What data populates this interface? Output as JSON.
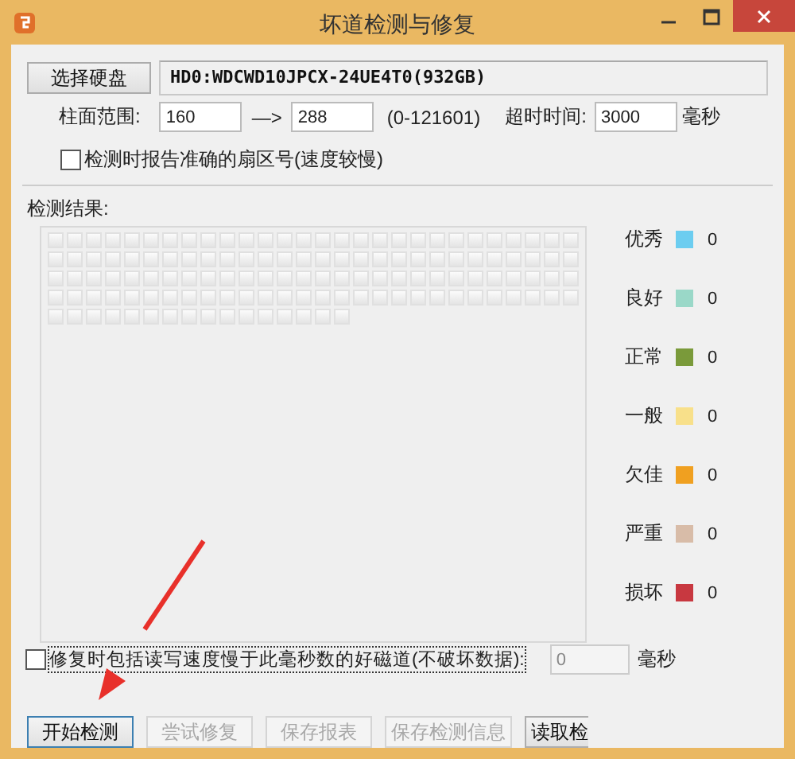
{
  "window": {
    "title": "坏道检测与修复"
  },
  "disk": {
    "button": "选择硬盘",
    "value": "HD0:WDCWD10JPCX-24UE4T0(932GB)"
  },
  "cylinder_range": {
    "label": "柱面范围:",
    "from": "160",
    "arrow": "—>",
    "to": "288",
    "limits": "(0-121601)"
  },
  "timeout": {
    "label": "超时时间:",
    "value": "3000",
    "unit": "毫秒"
  },
  "report_exact_sector": {
    "label": "检测时报告准确的扇区号(速度较慢)",
    "checked": false
  },
  "results": {
    "label": "检测结果:"
  },
  "legend": [
    {
      "label": "优秀",
      "color": "#6ccdf0",
      "count": "0"
    },
    {
      "label": "良好",
      "color": "#9ad8c8",
      "count": "0"
    },
    {
      "label": "正常",
      "color": "#7a9a3a",
      "count": "0"
    },
    {
      "label": "一般",
      "color": "#f8e08a",
      "count": "0"
    },
    {
      "label": "欠佳",
      "color": "#f0a020",
      "count": "0"
    },
    {
      "label": "严重",
      "color": "#d8bca8",
      "count": "0"
    },
    {
      "label": "损坏",
      "color": "#c83840",
      "count": "0"
    }
  ],
  "repair_slow": {
    "label": "修复时包括读写速度慢于此毫秒数的好磁道(不破坏数据):",
    "checked": false,
    "focused": true,
    "value": "0",
    "value_disabled": true,
    "unit": "毫秒"
  },
  "buttons": [
    {
      "label": "开始检测",
      "disabled": false
    },
    {
      "label": "尝试修复",
      "disabled": true
    },
    {
      "label": "保存报表",
      "disabled": true
    },
    {
      "label": "保存检测信息",
      "disabled": true
    },
    {
      "label": "读取检",
      "disabled": false
    }
  ],
  "annotation": {
    "kind": "arrow"
  }
}
